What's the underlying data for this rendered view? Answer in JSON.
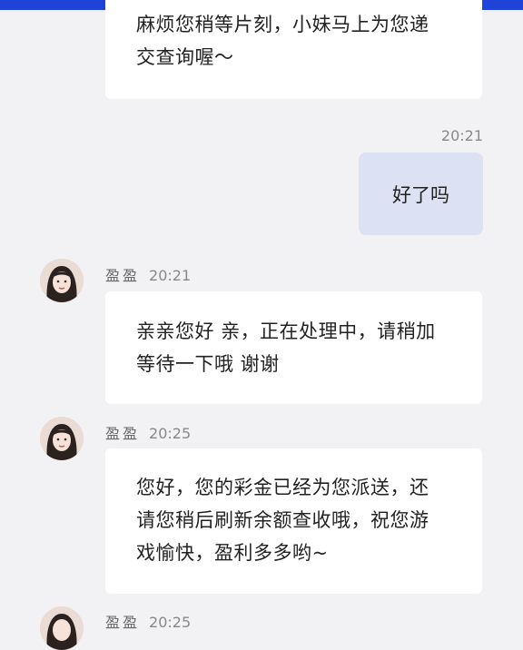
{
  "messages": [
    {
      "side": "in",
      "lines": [
        "麻烦您稍等片刻，小妹马上为您递",
        "交查询喔～"
      ]
    },
    {
      "side": "out",
      "time": "20:21",
      "text": "好了吗"
    },
    {
      "side": "in",
      "sender": "盈盈",
      "time": "20:21",
      "lines": [
        "亲亲您好 亲，正在处理中，请稍加",
        "等待一下哦 谢谢"
      ]
    },
    {
      "side": "in",
      "sender": "盈盈",
      "time": "20:25",
      "lines": [
        "您好，您的彩金已经为您派送，还",
        "请您稍后刷新余额查收哦，祝您游",
        "戏愉快，盈利多多哟~"
      ]
    },
    {
      "side": "in",
      "sender": "盈盈",
      "time": "20:25"
    }
  ],
  "colors": {
    "topbar": "#1f43d8",
    "outgoing_bubble": "#dde1f4",
    "incoming_bubble": "#ffffff",
    "background": "#f2f2f4"
  },
  "icons": {
    "avatar": "agent-avatar-icon"
  }
}
